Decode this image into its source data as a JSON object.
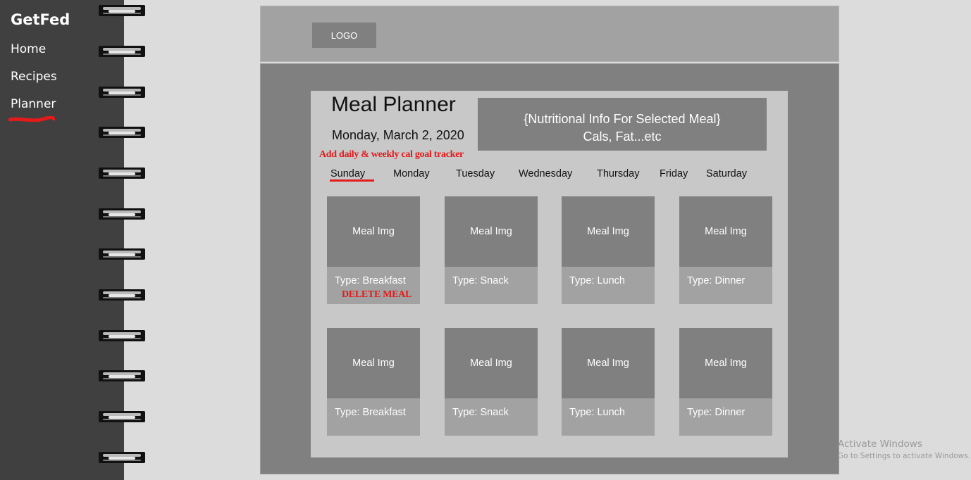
{
  "sidebar": {
    "brand": "GetFed",
    "items": [
      {
        "label": "Home"
      },
      {
        "label": "Recipes"
      },
      {
        "label": "Planner"
      }
    ]
  },
  "header": {
    "logo_label": "LOGO"
  },
  "planner": {
    "title": "Meal Planner",
    "date": "Monday, March 2, 2020",
    "nutrition_line1": "{Nutritional Info For Selected Meal}",
    "nutrition_line2": "Cals, Fat...etc",
    "annotation_goal": "Add daily & weekly cal goal tracker",
    "annotation_delete": "DELETE MEAL",
    "days": [
      "Sunday",
      "Monday",
      "Tuesday",
      "Wednesday",
      "Thursday",
      "Friday",
      "Saturday"
    ],
    "selected_day": "Sunday",
    "meals": [
      {
        "img": "Meal Img",
        "type": "Type: Breakfast"
      },
      {
        "img": "Meal Img",
        "type": "Type: Snack"
      },
      {
        "img": "Meal Img",
        "type": "Type: Lunch"
      },
      {
        "img": "Meal Img",
        "type": "Type: Dinner"
      },
      {
        "img": "Meal Img",
        "type": "Type: Breakfast"
      },
      {
        "img": "Meal Img",
        "type": "Type: Snack"
      },
      {
        "img": "Meal Img",
        "type": "Type: Lunch"
      },
      {
        "img": "Meal Img",
        "type": "Type: Dinner"
      }
    ]
  },
  "watermark": {
    "line1": "Activate Windows",
    "line2": "Go to Settings to activate Windows."
  },
  "colors": {
    "sidebar": "#404040",
    "accent_red": "#e31b1b",
    "card_dark": "#808080",
    "card_light": "#a2a2a2",
    "panel": "#c8c8c8"
  }
}
